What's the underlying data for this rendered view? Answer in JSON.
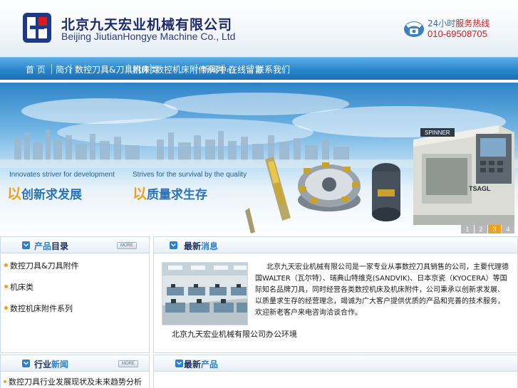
{
  "header": {
    "company_cn": "北京九天宏业机械有限公司",
    "company_en": "Beijing JiutianHongye Machine Co., Ltd",
    "hotline_prefix": "24小时",
    "hotline_label": "服务热线",
    "hotline_number": "010-69508705"
  },
  "nav": {
    "items": [
      "首 页",
      "简介",
      "数控刀具&刀具附件",
      "机床类",
      "数控机床附件系列",
      "新闻中心",
      "在线留言",
      "联系我们"
    ]
  },
  "banner": {
    "slogan1_en": "Innovates striver for development",
    "slogan1_big": "以",
    "slogan1_cn": "创新求发展",
    "slogan2_en": "Strives for the survival by the quality",
    "slogan2_big": "以",
    "slogan2_cn": "质量求生存",
    "machine_label": "SPINNER",
    "machine_model": "TSAGL",
    "pages": [
      "1",
      "2",
      "3",
      "4"
    ],
    "active_page": "3"
  },
  "products_panel": {
    "title_a": "产品",
    "title_b": "目录",
    "more": "MORE",
    "items": [
      "数控刀具&刀具附件",
      "机床类",
      "数控机床附件系列"
    ]
  },
  "news_panel": {
    "title_a": "最新",
    "title_b": "消息",
    "photo_caption": "北京九天宏业机械有限公司办公环境",
    "body": "北京九天宏业机械有限公司是一家专业从事数控刀具销售的公司，主要代理德国WALTER（瓦尔特）、瑞典山特维克(SANDVIK)、日本京瓷（KYOCERA）等国际知名品牌刀具，同时经营各类数控机床及机床附件，公司秉承以创新求发展、以质量求生存的经营理念，竭诚为广大客户提供优质的产品和完善的技术服务，欢迎新老客户来电咨询洽谈合作。"
  },
  "industry_panel": {
    "title_a": "行业",
    "title_b": "新闻",
    "more": "MORE",
    "items": [
      "数控刀具行业发展现状及未来趋势分析"
    ]
  },
  "latest_products_panel": {
    "title_a": "最新",
    "title_b": "产品"
  },
  "colors": {
    "nav_blue": "#2a85cc",
    "accent_orange": "#f0a020",
    "hotline_red": "#d81a1a",
    "brand_navy": "#1d2a6b"
  },
  "icons": {
    "logo": "company-logo-icon",
    "phone": "telephone-icon",
    "section_arrow": "chevron-down-icon"
  }
}
